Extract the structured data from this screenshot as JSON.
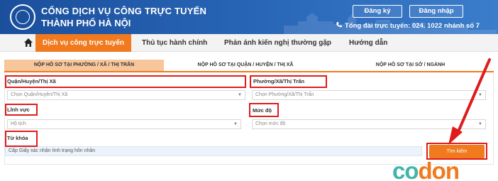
{
  "header": {
    "title_line1": "CỔNG DỊCH VỤ CÔNG TRỰC TUYẾN",
    "title_line2": "THÀNH PHỐ HÀ NỘI",
    "register_label": "Đăng ký",
    "login_label": "Đăng nhập",
    "hotline": "Tổng đài trực tuyến: 024. 1022 nhánh số 7"
  },
  "nav": {
    "items": [
      "Dịch vụ công trực tuyến",
      "Thủ tục hành chính",
      "Phản ánh kiến nghị thường gặp",
      "Hướng dẫn"
    ]
  },
  "tabs": [
    "NỘP HỒ SƠ TẠI PHƯỜNG / XÃ / THỊ TRẤN",
    "NỘP HỒ SƠ TẠI QUẬN / HUYỆN / THỊ XÃ",
    "NỘP HỒ SƠ TẠI SỞ / NGÀNH"
  ],
  "form": {
    "district_label": "Quận/Huyện/Thị Xã",
    "district_placeholder": "Chọn Quận/Huyện/Thị Xã",
    "ward_label": "Phường/Xã/Thị Trấn",
    "ward_placeholder": "Chọn Phường/Xã/Thị Trấn",
    "field_label": "Lĩnh vực",
    "field_value": "Hộ tịch",
    "level_label": "Mức độ",
    "level_placeholder": "Chọn mức độ",
    "keyword_label": "Từ khóa",
    "keyword_value": "Cấp Giấy xác nhận tình trạng hôn nhân",
    "search_label": "Tìm kiếm"
  },
  "watermark": {
    "part1": "co",
    "part2": "don"
  },
  "colors": {
    "header_blue": "#1a4f9c",
    "accent_orange": "#f07a1d",
    "annotation_red": "#e01b1b",
    "watermark_teal": "#3fb6ad"
  }
}
